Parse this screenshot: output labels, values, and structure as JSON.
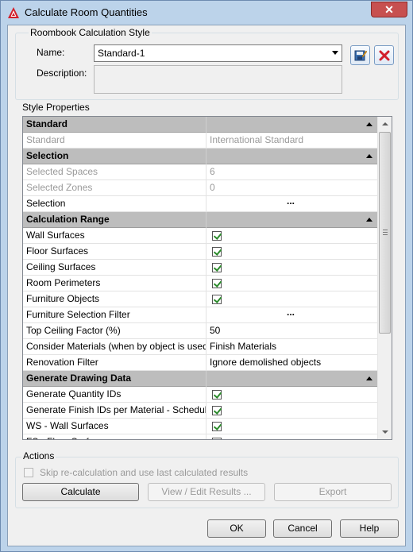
{
  "window": {
    "title": "Calculate Room Quantities",
    "close_glyph": "✕"
  },
  "style_group": {
    "title": "Roombook Calculation Style",
    "name_label": "Name:",
    "name_value": "Standard-1",
    "description_label": "Description:",
    "description_value": ""
  },
  "properties_group": {
    "title": "Style Properties",
    "rows": [
      {
        "kind": "category",
        "label": "Standard"
      },
      {
        "kind": "disabled",
        "label": "Standard",
        "value": "International Standard"
      },
      {
        "kind": "category",
        "label": "Selection"
      },
      {
        "kind": "disabled",
        "label": "Selected Spaces",
        "value": "6"
      },
      {
        "kind": "disabled",
        "label": "Selected Zones",
        "value": "0"
      },
      {
        "kind": "button",
        "label": "Selection",
        "value": "..."
      },
      {
        "kind": "category",
        "label": "Calculation Range"
      },
      {
        "kind": "check",
        "label": "Wall Surfaces"
      },
      {
        "kind": "check",
        "label": "Floor Surfaces"
      },
      {
        "kind": "check",
        "label": "Ceiling Surfaces"
      },
      {
        "kind": "check",
        "label": "Room Perimeters"
      },
      {
        "kind": "check",
        "label": "Furniture Objects"
      },
      {
        "kind": "button",
        "label": "Furniture Selection Filter",
        "value": "..."
      },
      {
        "kind": "text",
        "label": "Top Ceiling Factor (%)",
        "value": "50"
      },
      {
        "kind": "text",
        "label": "Consider Materials (when by object is used",
        "value": "Finish Materials"
      },
      {
        "kind": "text",
        "label": "Renovation Filter",
        "value": "Ignore demolished objects"
      },
      {
        "kind": "category",
        "label": "Generate Drawing Data"
      },
      {
        "kind": "check",
        "label": "Generate Quantity IDs"
      },
      {
        "kind": "check",
        "label": "Generate Finish IDs per Material - Schedule"
      },
      {
        "kind": "check",
        "label": "WS - Wall Surfaces"
      },
      {
        "kind": "check",
        "label": "FS - Floor Surfaces"
      }
    ]
  },
  "actions_group": {
    "title": "Actions",
    "skip_label": "Skip re-calculation and use last calculated results",
    "calculate_label": "Calculate",
    "view_edit_label": "View / Edit Results ...",
    "export_label": "Export"
  },
  "footer": {
    "ok_label": "OK",
    "cancel_label": "Cancel",
    "help_label": "Help"
  },
  "colors": {
    "category_bg": "#bdbdbd",
    "title_bar": "#bcd3ea",
    "close_red": "#c75050",
    "check_green": "#2a8a2a"
  }
}
